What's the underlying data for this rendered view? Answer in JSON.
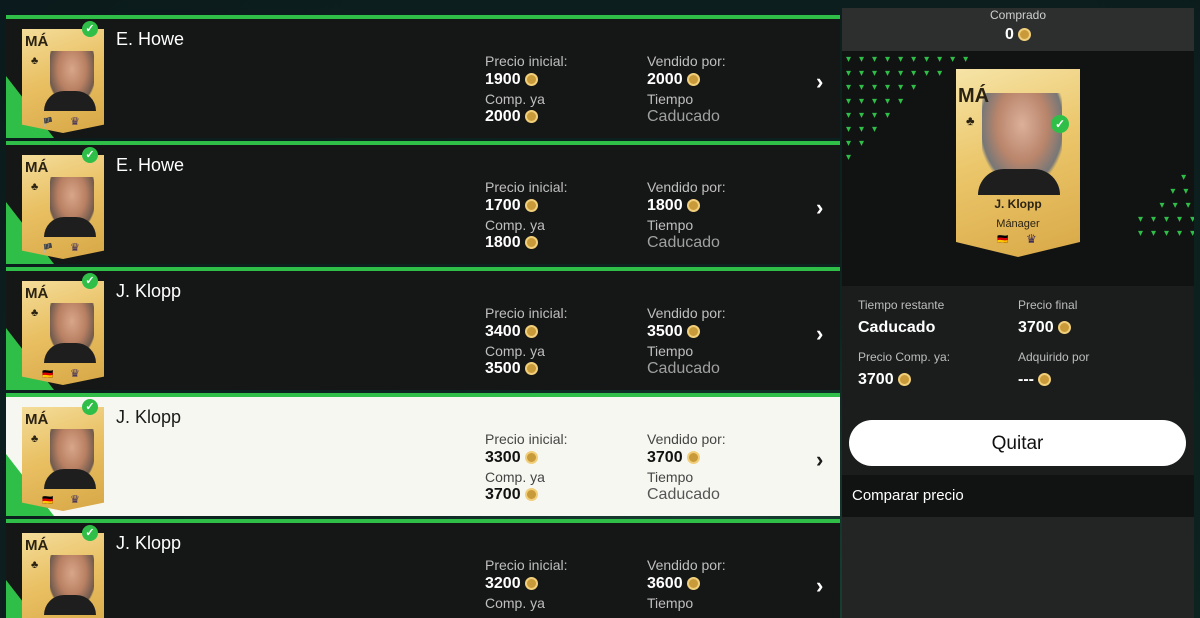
{
  "rows": [
    {
      "name": "E. Howe",
      "position": "MÁ",
      "flag": "🏴",
      "labels": {
        "start": "Precio inicial:",
        "buy_now": "Comp. ya",
        "sold_for": "Vendido por:",
        "time": "Tiempo"
      },
      "start_price": "1900",
      "buy_now_price": "2000",
      "sold_for": "2000",
      "status": "Caducado",
      "selected": false
    },
    {
      "name": "E. Howe",
      "position": "MÁ",
      "flag": "🏴",
      "labels": {
        "start": "Precio inicial:",
        "buy_now": "Comp. ya",
        "sold_for": "Vendido por:",
        "time": "Tiempo"
      },
      "start_price": "1700",
      "buy_now_price": "1800",
      "sold_for": "1800",
      "status": "Caducado",
      "selected": false
    },
    {
      "name": "J. Klopp",
      "position": "MÁ",
      "flag": "🇩🇪",
      "labels": {
        "start": "Precio inicial:",
        "buy_now": "Comp. ya",
        "sold_for": "Vendido por:",
        "time": "Tiempo"
      },
      "start_price": "3400",
      "buy_now_price": "3500",
      "sold_for": "3500",
      "status": "Caducado",
      "selected": false
    },
    {
      "name": "J. Klopp",
      "position": "MÁ",
      "flag": "🇩🇪",
      "labels": {
        "start": "Precio inicial:",
        "buy_now": "Comp. ya",
        "sold_for": "Vendido por:",
        "time": "Tiempo"
      },
      "start_price": "3300",
      "buy_now_price": "3700",
      "sold_for": "3700",
      "status": "Caducado",
      "selected": true
    },
    {
      "name": "J. Klopp",
      "position": "MÁ",
      "flag": "🇩🇪",
      "labels": {
        "start": "Precio inicial:",
        "buy_now": "Comp. ya",
        "sold_for": "Vendido por:",
        "time": "Tiempo"
      },
      "start_price": "3200",
      "buy_now_price": "",
      "sold_for": "3600",
      "status": "",
      "selected": false
    }
  ],
  "panel": {
    "bought_label": "Comprado",
    "bought_value": "0",
    "card": {
      "position": "MÁ",
      "name": "J. Klopp",
      "role": "Mánager",
      "flag": "🇩🇪"
    },
    "time_left_label": "Tiempo restante",
    "time_left_value": "Caducado",
    "final_price_label": "Precio final",
    "final_price_value": "3700",
    "buy_now_label": "Precio Comp. ya:",
    "buy_now_value": "3700",
    "acquired_label": "Adquirido por",
    "acquired_value": "---",
    "quit_label": "Quitar",
    "compare_label": "Comparar precio"
  },
  "colors": {
    "accent": "#2fbf48",
    "card_gold": "#e9c063",
    "row_bg": "#151616",
    "selected_bg": "#f7f7f2"
  }
}
